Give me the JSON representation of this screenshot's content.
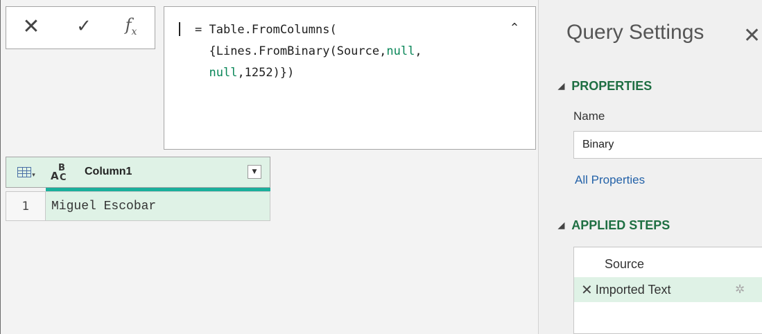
{
  "toolbar": {
    "cancel_glyph": "✕",
    "commit_glyph": "✓",
    "fx_glyph": "f",
    "fx_sub": "x"
  },
  "formula": {
    "line1": "= Table.FromColumns(",
    "line2_a": "{Lines.FromBinary(Source,",
    "line2_kw": "null",
    "line2_b": ",",
    "line3_kw": "null",
    "line3_b": ",1252)})",
    "collapse_glyph": "⌃"
  },
  "grid": {
    "column_header": "Column1",
    "type_icon": {
      "a": "A",
      "b": "B",
      "c": "C"
    },
    "filter_glyph": "▼",
    "rows": [
      {
        "num": "1",
        "value": "Miguel Escobar"
      }
    ]
  },
  "settings": {
    "title": "Query Settings",
    "close_glyph": "✕",
    "properties_header": "PROPERTIES",
    "name_label": "Name",
    "name_value": "Binary",
    "all_properties_link": "All Properties",
    "applied_steps_header": "APPLIED STEPS",
    "steps": [
      {
        "label": "Source"
      },
      {
        "label": "Imported Text"
      }
    ],
    "section_triangle": "◢",
    "step_delete_glyph": "✕",
    "step_gear_glyph": "✲"
  },
  "colors": {
    "accent_green": "#1f6f43",
    "selection_green": "#dff2e6",
    "quality_bar": "#1aaf9b",
    "link_blue": "#2462a8",
    "keyword_green": "#098658"
  }
}
